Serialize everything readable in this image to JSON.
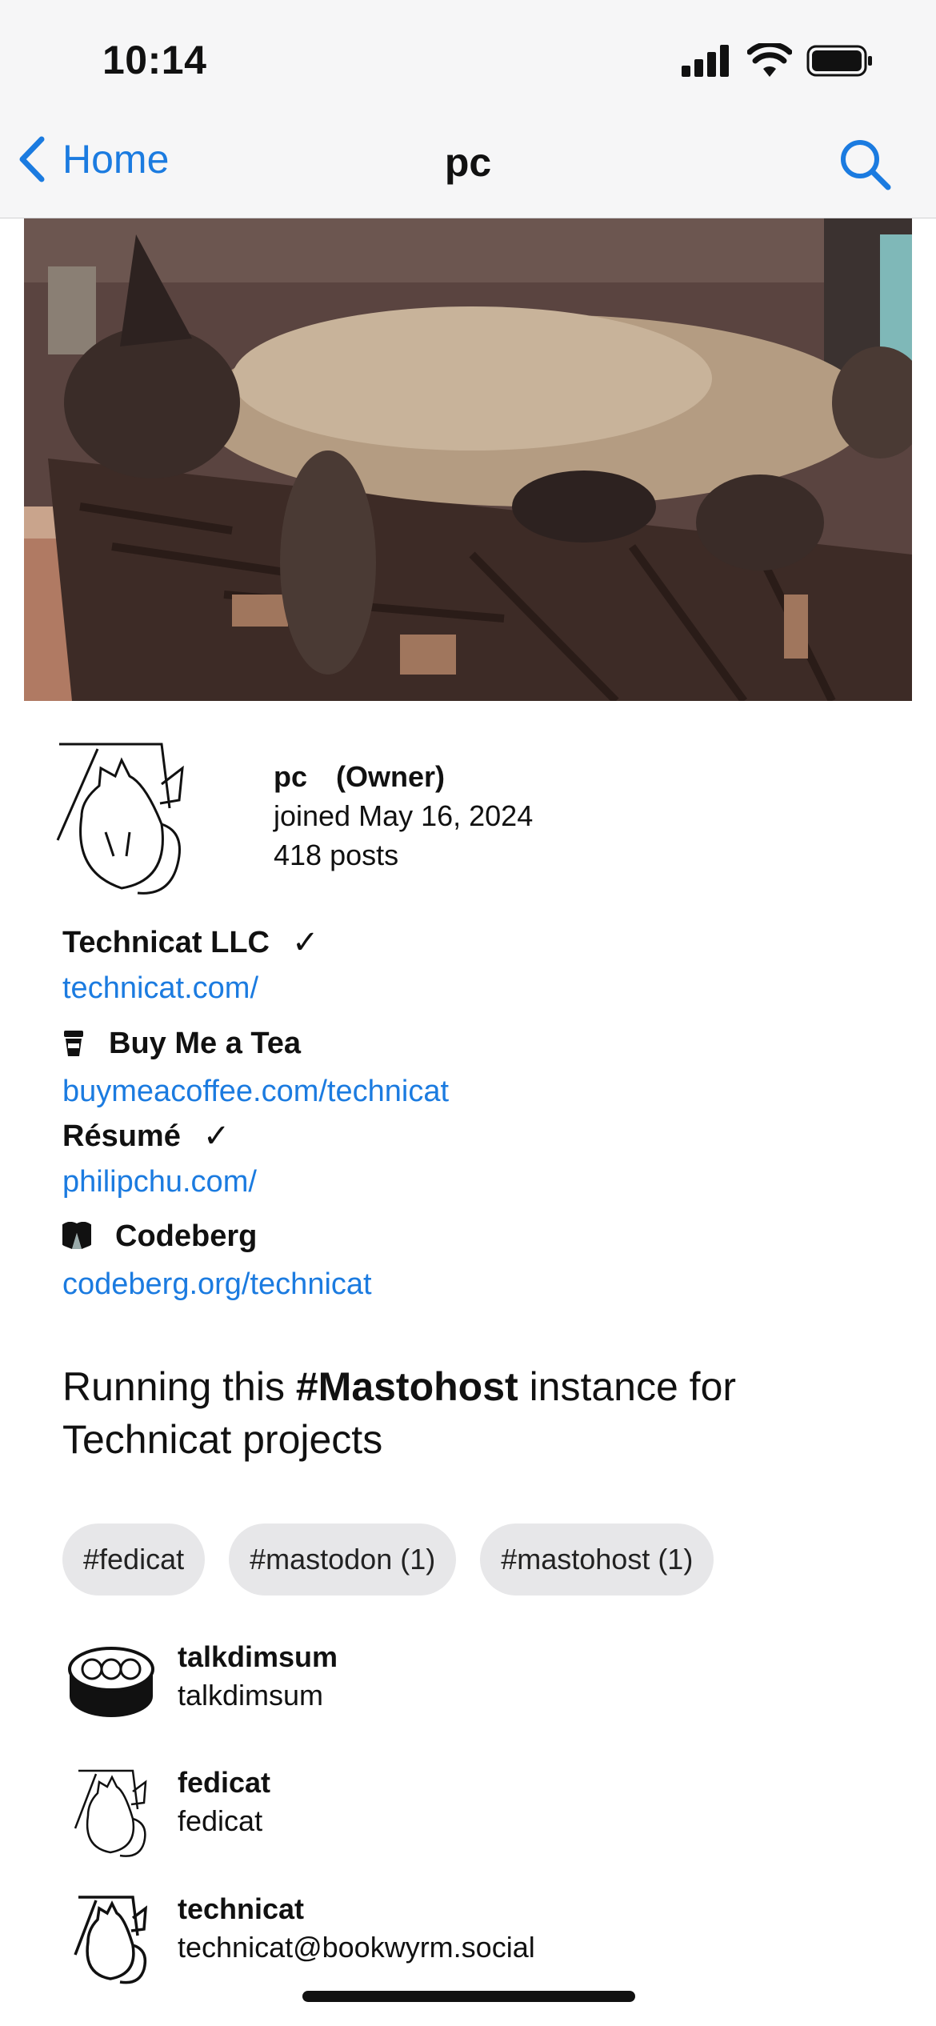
{
  "status_bar": {
    "time": "10:14"
  },
  "nav": {
    "back_label": "Home",
    "title": "pc"
  },
  "profile": {
    "name": "pc",
    "role": "(Owner)",
    "joined": "joined May 16, 2024",
    "posts": "418 posts"
  },
  "fields": [
    {
      "name": "Technicat LLC",
      "verified": true,
      "value": "technicat.com/"
    },
    {
      "name": "Buy Me a Tea",
      "icon": "tea-cup-icon",
      "value": "buymeacoffee.com/technicat"
    },
    {
      "name": "Résumé",
      "verified": true,
      "value": "philipchu.com/"
    },
    {
      "name": "Codeberg",
      "icon": "codeberg-icon",
      "value": "codeberg.org/technicat"
    }
  ],
  "check_mark": "✓",
  "bio": {
    "before": "Running this ",
    "hashtag": "#Mastohost",
    "after": " instance for Technicat projects"
  },
  "tags": [
    "#fedicat",
    "#mastodon (1)",
    "#mastohost (1)"
  ],
  "accounts": [
    {
      "name": "talkdimsum",
      "handle": "talkdimsum"
    },
    {
      "name": "fedicat",
      "handle": "fedicat"
    },
    {
      "name": "technicat",
      "handle": "technicat@bookwyrm.social"
    }
  ],
  "colors": {
    "link": "#1b7be0",
    "tag_bg": "#e7e7e9",
    "bar_bg": "#f6f6f7"
  }
}
